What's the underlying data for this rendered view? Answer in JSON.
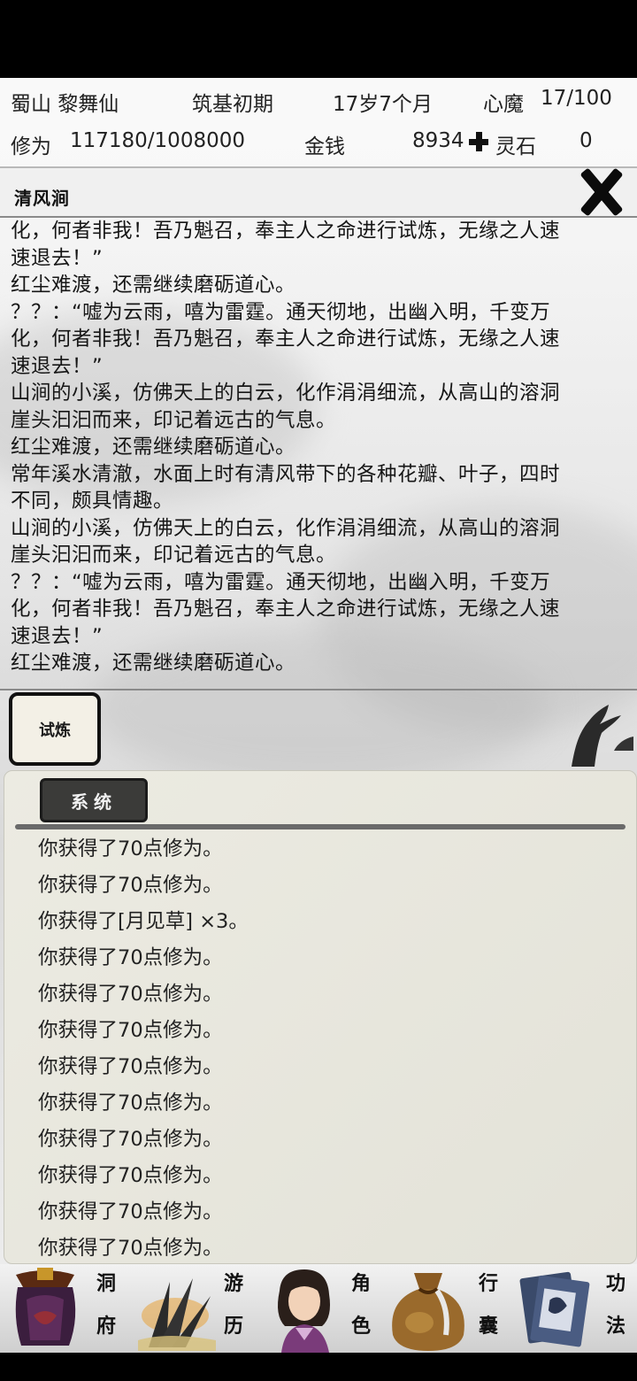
{
  "status": {
    "sect_name": "蜀山 黎舞仙",
    "realm": "筑基初期",
    "age": "17岁7个月",
    "demon_label": "心魔",
    "demon_value": "17/100",
    "cultivation_label": "修为",
    "cultivation_value": "117180/1008000",
    "money_label": "金钱",
    "money_value": "8934",
    "spirit_stone_label": "灵石",
    "spirit_stone_value": "0"
  },
  "location": {
    "title": "清风涧"
  },
  "story_lines": [
    "化，何者非我！吾乃魁召，奉主人之命进行试炼，无缘之人速",
    "速退去！”",
    "红尘难渡，还需继续磨砺道心。",
    "？？：“嘘为云雨，嘻为雷霆。通天彻地，出幽入明，千变万",
    "化，何者非我！吾乃魁召，奉主人之命进行试炼，无缘之人速",
    "速退去！”",
    "山涧的小溪，仿佛天上的白云，化作涓涓细流，从高山的溶洞",
    "崖头汩汩而来，印记着远古的气息。",
    "红尘难渡，还需继续磨砺道心。",
    "常年溪水清澈，水面上时有清风带下的各种花瓣、叶子，四时",
    "不同，颇具情趣。",
    "山涧的小溪，仿佛天上的白云，化作涓涓细流，从高山的溶洞",
    "崖头汩汩而来，印记着远古的气息。",
    "？？：“嘘为云雨，嘻为雷霆。通天彻地，出幽入明，千变万",
    "化，何者非我！吾乃魁召，奉主人之命进行试炼，无缘之人速",
    "速退去！”",
    "红尘难渡，还需继续磨砺道心。"
  ],
  "actions": {
    "trial_label": "试炼"
  },
  "system": {
    "tab_label": "系统",
    "messages": [
      "你获得了70点修为。",
      "你获得了70点修为。",
      "你获得了[月见草] ×3。",
      "你获得了70点修为。",
      "你获得了70点修为。",
      "你获得了70点修为。",
      "你获得了70点修为。",
      "你获得了70点修为。",
      "你获得了70点修为。",
      "你获得了70点修为。",
      "你获得了70点修为。",
      "你获得了70点修为。"
    ]
  },
  "nav": {
    "cave": {
      "c1": "洞",
      "c2": "府",
      "icon": "cave-lantern-icon"
    },
    "travel": {
      "c1": "游",
      "c2": "历",
      "icon": "travel-grass-icon"
    },
    "character": {
      "c1": "角",
      "c2": "色",
      "icon": "character-portrait-icon"
    },
    "bag": {
      "c1": "行",
      "c2": "囊",
      "icon": "bag-sack-icon"
    },
    "skills": {
      "c1": "功",
      "c2": "法",
      "icon": "skills-book-icon"
    }
  },
  "colors": {
    "accent_dark": "#3b3b39",
    "panel_bg": "#ecebe2"
  }
}
